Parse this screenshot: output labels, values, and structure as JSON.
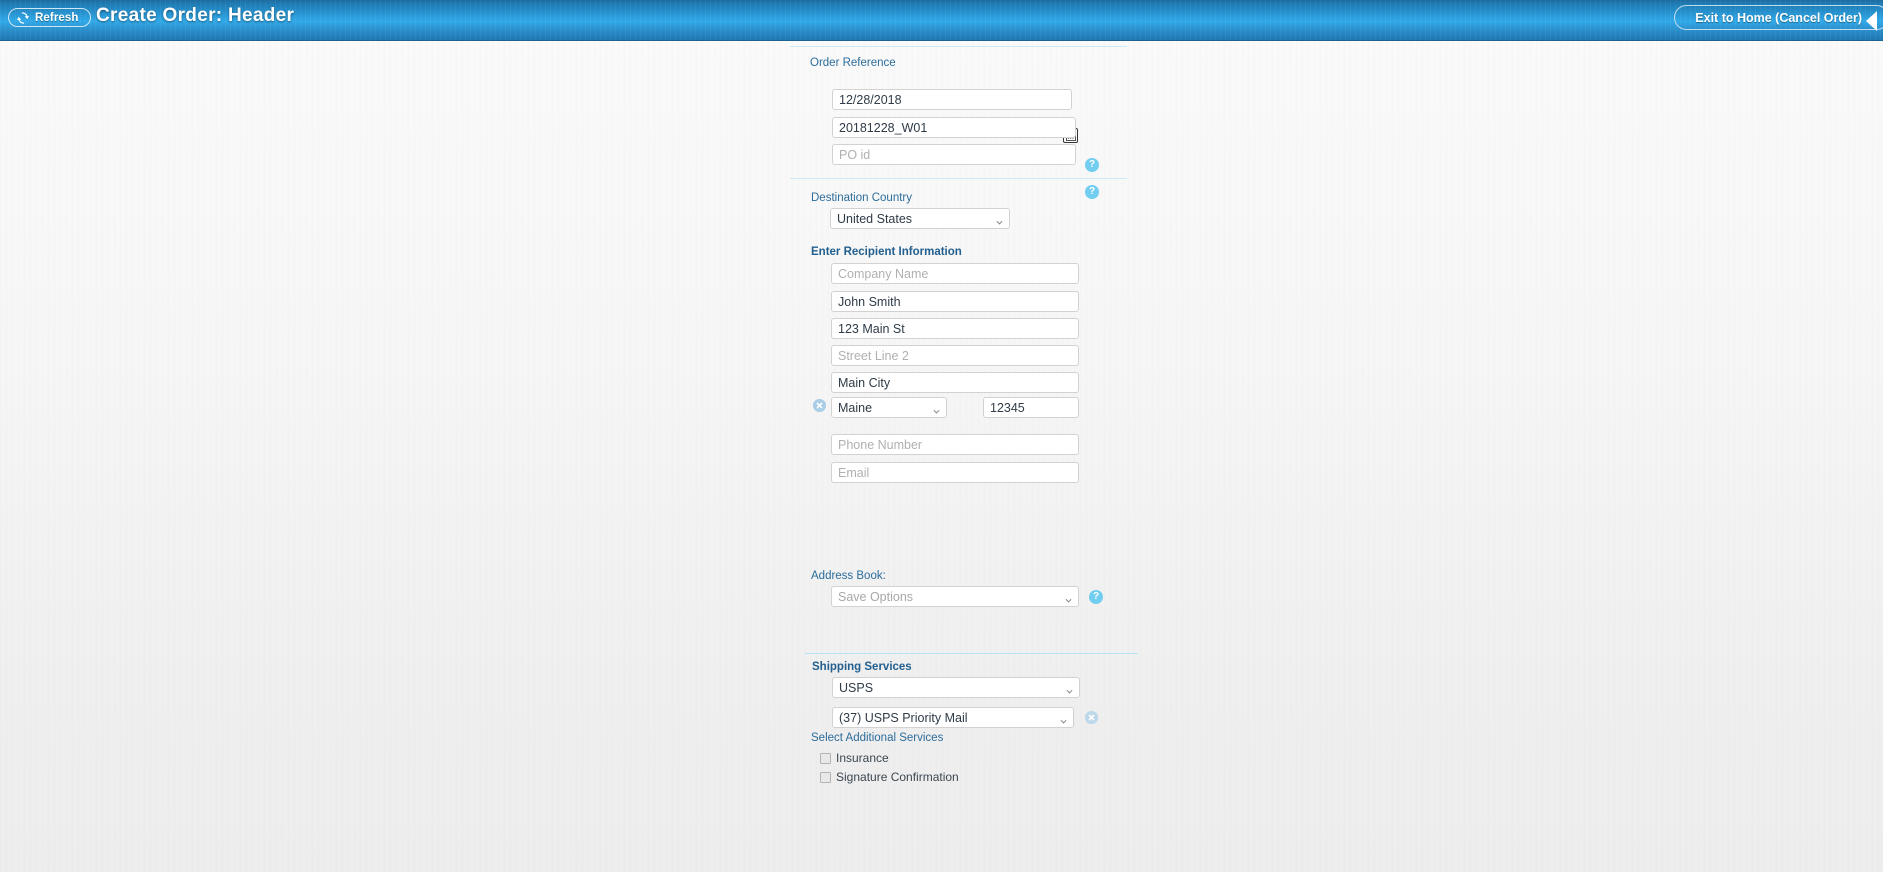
{
  "header": {
    "refresh_label": "Refresh",
    "title": "Create Order: Header",
    "exit_label": "Exit to Home  (Cancel Order)",
    "refresh_icon": "refresh-icon",
    "exit_icon": "chevron-left-icon",
    "gradient_top": "#1d6ca0",
    "gradient_mid": "#31a9e8",
    "gradient_bottom": "#1f76ae",
    "text_color": "#ffffff"
  },
  "order_reference": {
    "legend": "Order Reference",
    "date_value": "12/28/2018",
    "calendar_icon": "calendar-icon",
    "order_id_value": "20181228_W01",
    "order_id_help_icon": "help-icon",
    "po_id_placeholder": "PO id",
    "po_id_value": "",
    "po_id_help_icon": "help-icon"
  },
  "destination": {
    "label": "Destination Country",
    "country_value": "United States",
    "caret_icon": "chevron-down-icon"
  },
  "recipient": {
    "legend": "Enter Recipient Information",
    "company_placeholder": "Company Name",
    "company_value": "",
    "name_value": "John Smith",
    "street1_value": "123 Main St",
    "street2_placeholder": "Street Line 2",
    "street2_value": "",
    "city_value": "Main City",
    "state_value": "Maine",
    "state_clear_icon": "clear-icon",
    "zip_value": "12345",
    "phone_placeholder": "Phone Number",
    "phone_value": "",
    "email_placeholder": "Email",
    "email_value": ""
  },
  "address_book": {
    "label": "Address Book:",
    "save_options_value": "Save Options",
    "help_icon": "help-icon",
    "caret_icon": "chevron-down-icon"
  },
  "shipping": {
    "legend": "Shipping Services",
    "carrier_value": "USPS",
    "service_value": "(37)  USPS Priority Mail",
    "service_clear_icon": "clear-icon",
    "additional_label": "Select Additional Services",
    "options": [
      {
        "label": "Insurance",
        "checked": false
      },
      {
        "label": "Signature Confirmation",
        "checked": false
      }
    ]
  },
  "colors": {
    "accent_blue": "#2c6c9b",
    "help_blue": "#72cef0",
    "rule_blue": "#b8e2f5",
    "page_bg": "#f4f4f4"
  }
}
